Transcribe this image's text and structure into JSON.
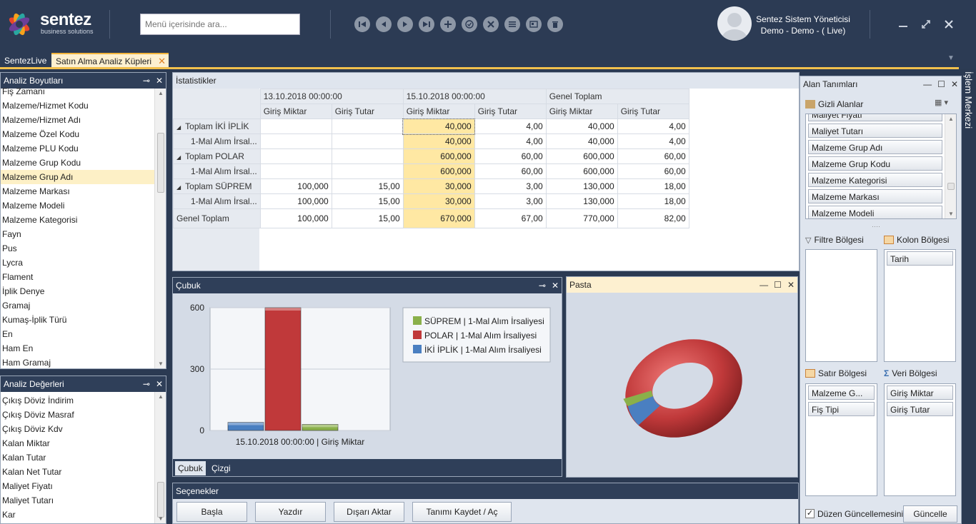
{
  "app": {
    "logo_title": "sentez",
    "logo_subtitle": "business solutions"
  },
  "search": {
    "placeholder": "Menü içerisinde ara..."
  },
  "user": {
    "name": "Sentez Sistem Yöneticisi",
    "context": "Demo - Demo - ( Live)"
  },
  "tabs": [
    {
      "label": "SentezLive"
    },
    {
      "label": "Satın Alma Analiz Küpleri"
    }
  ],
  "dimensions": {
    "title": "Analiz Boyutları",
    "items": [
      "Fiş Zamanı",
      "Malzeme/Hizmet Kodu",
      "Malzeme/Hizmet Adı",
      "Malzeme Özel Kodu",
      "Malzeme PLU Kodu",
      "Malzeme Grup Kodu",
      "Malzeme Grup Adı",
      "Malzeme Markası",
      "Malzeme Modeli",
      "Malzeme Kategorisi",
      "Fayn",
      "Pus",
      "Lycra",
      "Flament",
      "İplik Denye",
      "Gramaj",
      "Kumaş-İplik Türü",
      "En",
      "Ham En",
      "Ham Gramaj"
    ],
    "selected": "Malzeme Grup Adı"
  },
  "values": {
    "title": "Analiz Değerleri",
    "items": [
      "Çıkış Döviz İndirim",
      "Çıkış Döviz Masraf",
      "Çıkış Döviz Kdv",
      "Kalan Miktar",
      "Kalan Tutar",
      "Kalan Net Tutar",
      "Maliyet Fiyatı",
      "Maliyet Tutarı",
      "Kar"
    ]
  },
  "pivot": {
    "title": "İstatistikler",
    "col_groups": [
      "13.10.2018 00:00:00",
      "15.10.2018 00:00:00",
      "Genel Toplam"
    ],
    "measures": [
      "Giriş Miktar",
      "Giriş Tutar",
      "Giriş Miktar",
      "Giriş Tutar",
      "Giriş Miktar",
      "Giriş Tutar"
    ],
    "rows": [
      {
        "label": "Toplam İKİ İPLİK",
        "expander": "◢",
        "cells": [
          "",
          "",
          "40,000",
          "4,00",
          "40,000",
          "4,00"
        ]
      },
      {
        "label": "1-Mal Alım İrsal...",
        "expander": "",
        "cells": [
          "",
          "",
          "40,000",
          "4,00",
          "40,000",
          "4,00"
        ]
      },
      {
        "label": "Toplam POLAR",
        "expander": "◢",
        "cells": [
          "",
          "",
          "600,000",
          "60,00",
          "600,000",
          "60,00"
        ]
      },
      {
        "label": "1-Mal Alım İrsal...",
        "expander": "",
        "cells": [
          "",
          "",
          "600,000",
          "60,00",
          "600,000",
          "60,00"
        ]
      },
      {
        "label": "Toplam SÜPREM",
        "expander": "◢",
        "cells": [
          "100,000",
          "15,00",
          "30,000",
          "3,00",
          "130,000",
          "18,00"
        ]
      },
      {
        "label": "1-Mal Alım İrsal...",
        "expander": "",
        "cells": [
          "100,000",
          "15,00",
          "30,000",
          "3,00",
          "130,000",
          "18,00"
        ]
      },
      {
        "label": "Genel Toplam",
        "expander": "",
        "cells": [
          "100,000",
          "15,00",
          "670,000",
          "67,00",
          "770,000",
          "82,00"
        ]
      }
    ]
  },
  "bar_panel": {
    "title": "Çubuk",
    "tabs": [
      "Çubuk",
      "Çizgi"
    ]
  },
  "pie_panel": {
    "title": "Pasta"
  },
  "chart_data": [
    {
      "type": "bar",
      "categories": [
        "15.10.2018 00:00:00 | Giriş Miktar"
      ],
      "ylim": [
        0,
        600
      ],
      "yticks": [
        0,
        300,
        600
      ],
      "series": [
        {
          "name": "İKİ İPLİK | 1-Mal Alım İrsaliyesi",
          "color": "#4a7fc1",
          "values": [
            40
          ]
        },
        {
          "name": "POLAR | 1-Mal Alım İrsaliyesi",
          "color": "#c0393a",
          "values": [
            600
          ]
        },
        {
          "name": "SÜPREM | 1-Mal Alım İrsaliyesi",
          "color": "#8ab04a",
          "values": [
            30
          ]
        }
      ],
      "legend": [
        "SÜPREM | 1-Mal Alım İrsaliyesi",
        "POLAR | 1-Mal Alım İrsaliyesi",
        "İKİ İPLİK | 1-Mal Alım İrsaliyesi"
      ],
      "legend_colors": [
        "#8ab04a",
        "#c0393a",
        "#4a7fc1"
      ],
      "legend_position": "top-right"
    },
    {
      "type": "pie",
      "shape": "doughnut-3d",
      "values": [
        600,
        40,
        30
      ],
      "colors": [
        "#c0393a",
        "#4a7fc1",
        "#8ab04a"
      ]
    }
  ],
  "fields": {
    "title": "Alan Tanımları",
    "hidden_title": "Gizli Alanlar",
    "hidden": [
      "Maliyet Fiyatı",
      "Maliyet Tutarı",
      "Malzeme Grup Adı",
      "Malzeme Grup Kodu",
      "Malzeme Kategorisi",
      "Malzeme Markası",
      "Malzeme Modeli"
    ],
    "filter_title": "Filtre Bölgesi",
    "column_title": "Kolon Bölgesi",
    "columns": [
      "Tarih"
    ],
    "row_title": "Satır Bölgesi",
    "rows": [
      "Malzeme G...",
      "Fiş Tipi"
    ],
    "data_title": "Veri Bölgesi",
    "data": [
      "Giriş Miktar",
      "Giriş Tutar"
    ],
    "defer_label": "Düzen Güncellemesini",
    "update_label": "Güncelle"
  },
  "options": {
    "title": "Seçenekler",
    "buttons": [
      "Başla",
      "Yazdır",
      "Dışarı Aktar",
      "Tanımı Kaydet / Aç"
    ]
  },
  "side_tab": "İşlem Merkezi"
}
